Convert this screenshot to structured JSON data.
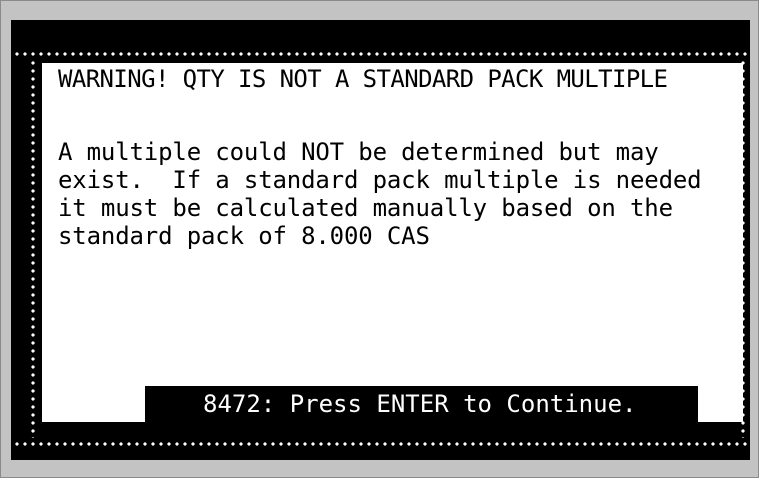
{
  "dialog": {
    "title": "WARNING! QTY IS NOT A STANDARD PACK MULTIPLE",
    "message_lines": [
      "A multiple could NOT be determined but may",
      "exist.  If a standard pack multiple is needed",
      "it must be calculated manually based on the",
      "standard pack of 8.000 CAS"
    ],
    "continue_prompt": "8472: Press ENTER to Continue."
  }
}
